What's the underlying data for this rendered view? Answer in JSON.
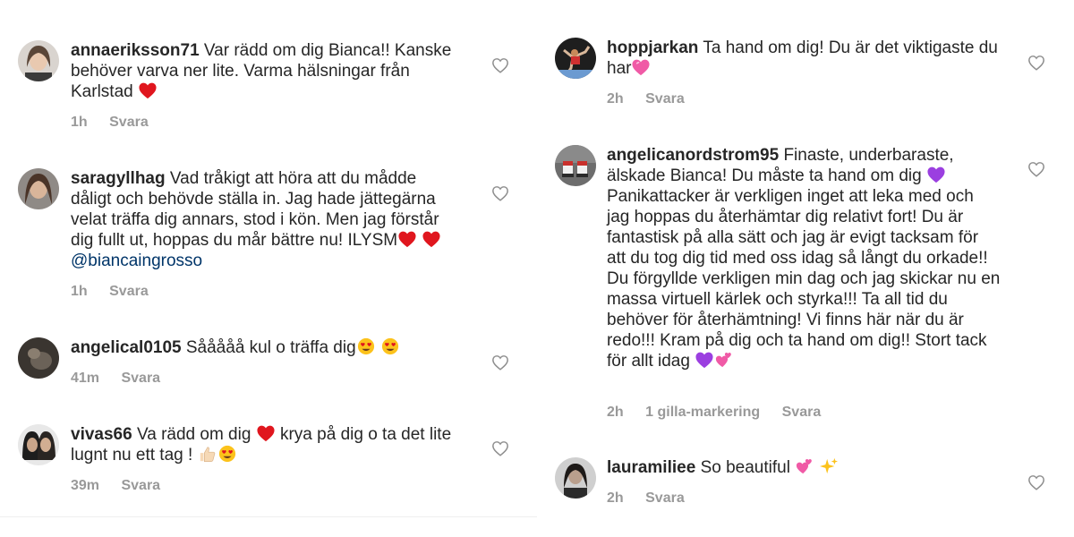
{
  "left_column": [
    {
      "username": "annaeriksson71",
      "text": "Var rädd om dig Bianca!! Kanske behöver varva ner lite. Varma hälsningar från Karlstad",
      "time": "1h",
      "reply_label": "Svara"
    },
    {
      "username": "saragyllhag",
      "text": "Vad tråkigt att höra att du mådde dåligt och behövde ställa in. Jag hade jättegärna velat träffa dig annars, stod i kön. Men jag förstår dig fullt ut, hoppas du mår bättre nu! ILYSM",
      "mention": "@biancaingrosso",
      "time": "1h",
      "reply_label": "Svara"
    },
    {
      "username": "angelical0105",
      "text": "Sååååå kul o träffa dig",
      "time": "41m",
      "reply_label": "Svara"
    },
    {
      "username": "vivas66",
      "text_a": "Va rädd om dig",
      "text_b": "krya på dig o ta det lite lugnt nu ett tag !",
      "time": "39m",
      "reply_label": "Svara"
    }
  ],
  "right_column": [
    {
      "username": "hoppjarkan",
      "text": "Ta hand om dig! Du är det viktigaste du har",
      "time": "2h",
      "reply_label": "Svara"
    },
    {
      "username": "angelicanordstrom95",
      "text_a": "Finaste, underbaraste, älskade Bianca! Du måste ta hand om dig",
      "text_b": "Panikattacker är verkligen inget att leka med och jag hoppas du återhämtar dig relativt fort! Du är fantastisk på alla sätt och jag är evigt tacksam för att du tog dig tid med oss idag så långt du orkade!! Du förgyllde verkligen min dag och jag skickar nu en massa virtuell kärlek och styrka!!! Ta all tid du behöver för återhämtning! Vi finns här när du är redo!!! Kram på dig och ta hand om dig!! Stort tack för allt idag",
      "time": "2h",
      "likes": "1 gilla-markering",
      "reply_label": "Svara"
    },
    {
      "username": "lauramiliee",
      "text": "So beautiful",
      "time": "2h",
      "reply_label": "Svara"
    }
  ],
  "icons": {
    "like": "heart-outline-icon",
    "emoji_red_heart": "red-heart-emoji",
    "emoji_heart_eyes": "heart-eyes-emoji",
    "emoji_thumbs_up": "thumbs-up-emoji",
    "emoji_pink_heart": "sparkling-heart-emoji",
    "emoji_purple_heart": "purple-heart-emoji",
    "emoji_two_hearts": "two-hearts-emoji",
    "emoji_sparkles": "sparkles-emoji"
  },
  "colors": {
    "text": "#262626",
    "meta": "#999999",
    "mention": "#003569",
    "heart_outline": "#8e8e8e"
  }
}
